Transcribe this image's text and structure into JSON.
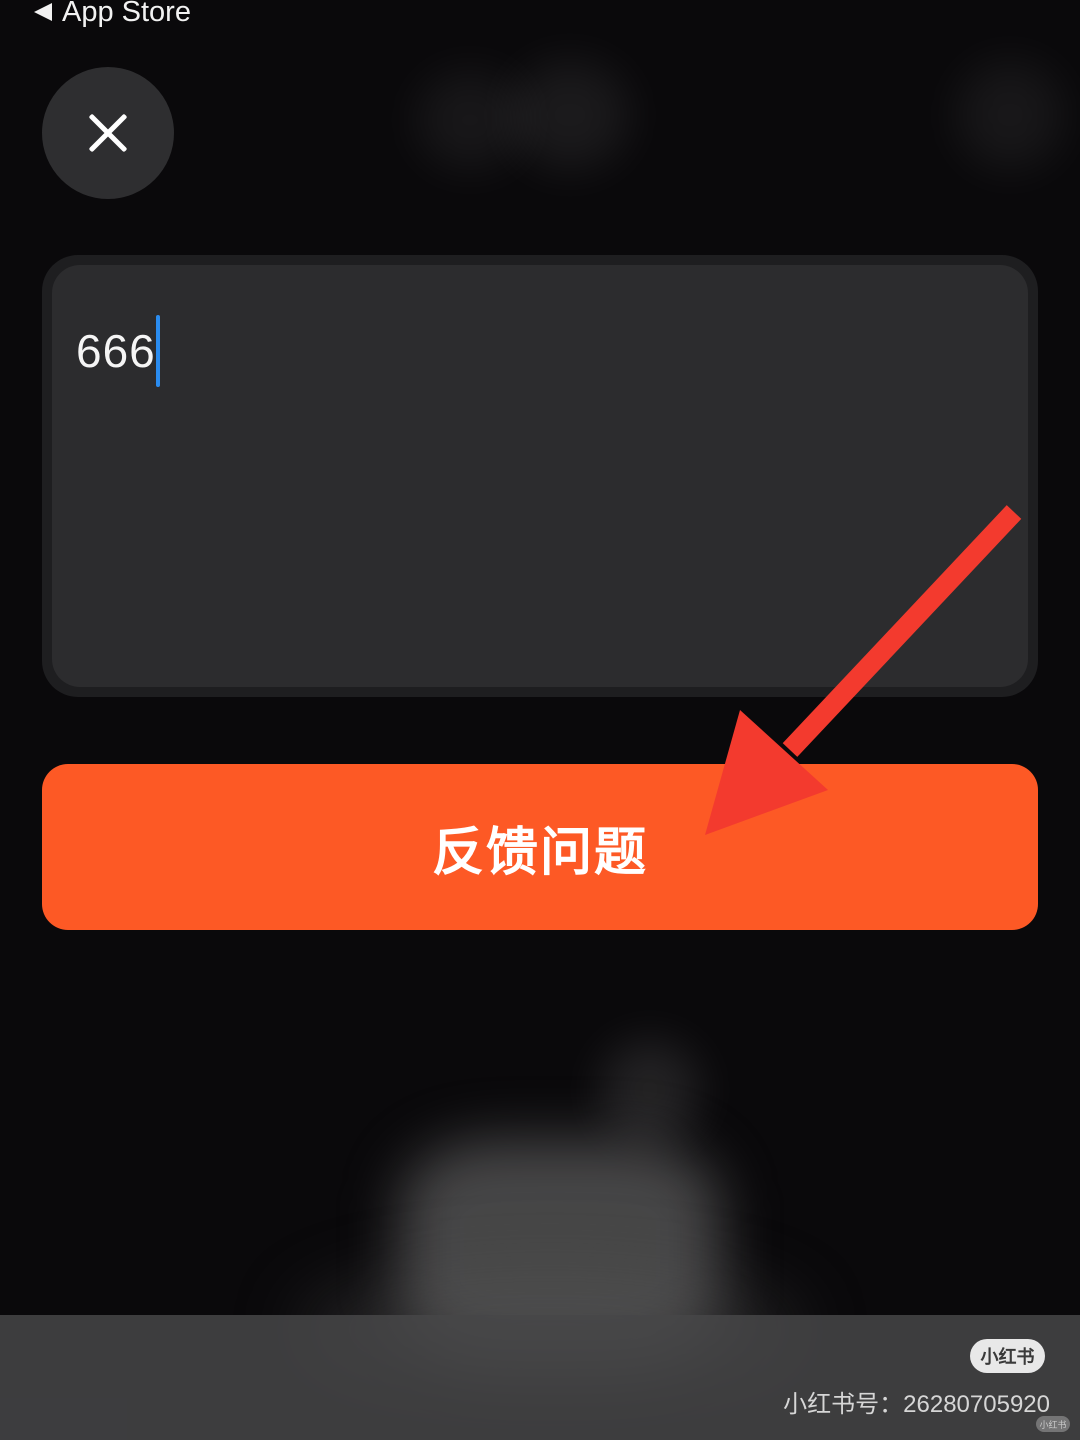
{
  "status_bar": {
    "back_label": "App Store"
  },
  "feedback": {
    "input_value": "666",
    "submit_label": "反馈问题"
  },
  "watermark": {
    "logo_text": "小红书",
    "account_text": "小红书号：26280705920",
    "mini_logo_text": "小红书"
  },
  "colors": {
    "background": "#0a090b",
    "accent": "#fd5925",
    "annotation_arrow": "#f33a2e",
    "cursor": "#2a8cf0"
  },
  "icons": {
    "close": "close-icon",
    "back": "back-arrow-icon"
  }
}
